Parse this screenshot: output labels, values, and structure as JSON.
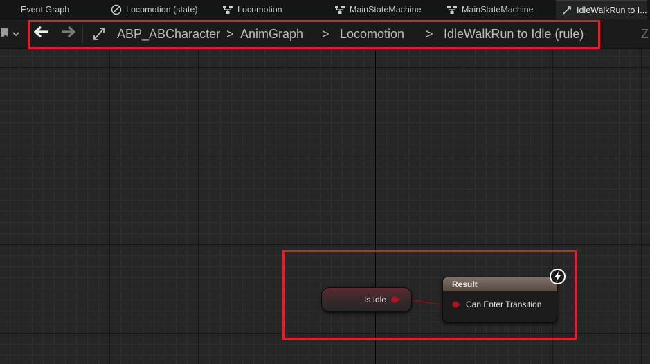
{
  "tabs": [
    {
      "label": "Event Graph",
      "icon": "event-graph-icon"
    },
    {
      "label": "Locomotion (state)",
      "icon": "state-icon"
    },
    {
      "label": "Locomotion",
      "icon": "state-machine-icon"
    },
    {
      "label": "MainStateMachine",
      "icon": "state-machine-icon"
    },
    {
      "label": "MainStateMachine",
      "icon": "state-machine-icon"
    },
    {
      "label": "IdleWalkRun to I...",
      "icon": "transition-icon"
    }
  ],
  "tab_overflow_glyph": "Z",
  "breadcrumb": {
    "items": [
      "ABP_ABCharacter",
      "AnimGraph",
      "Locomotion",
      "IdleWalkRun to Idle (rule)"
    ],
    "separator": ">"
  },
  "nodes": {
    "is_idle": {
      "label": "Is Idle"
    },
    "result": {
      "title": "Result",
      "pin_label": "Can Enter Transition"
    }
  },
  "colors": {
    "highlight": "#e0202a",
    "bool_pin": "#b3121d",
    "graph_bg": "#262626"
  }
}
